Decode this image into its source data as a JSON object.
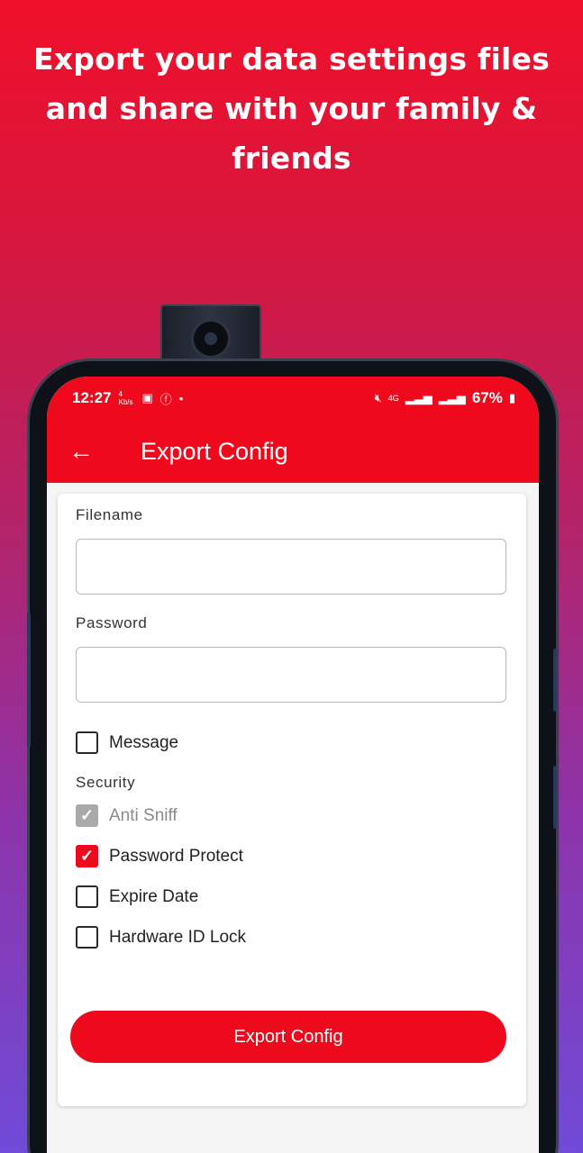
{
  "promo": {
    "headline_line1": "Export your data settings files",
    "headline_line2": "and share with your family &",
    "headline_line3": "friends"
  },
  "status_bar": {
    "time": "12:27",
    "net_speed": "4 Kb/s",
    "battery": "67%"
  },
  "app_bar": {
    "title": "Export Config"
  },
  "form": {
    "filename_label": "Filename",
    "filename_value": "",
    "password_label": "Password",
    "password_value": "",
    "message_label": "Message",
    "message_checked": false,
    "security_label": "Security",
    "options": [
      {
        "label": "Anti Sniff",
        "checked": true,
        "disabled": true
      },
      {
        "label": "Password Protect",
        "checked": true,
        "disabled": false
      },
      {
        "label": "Expire Date",
        "checked": false,
        "disabled": false
      },
      {
        "label": "Hardware ID Lock",
        "checked": false,
        "disabled": false
      }
    ],
    "export_button": "Export Config"
  },
  "colors": {
    "accent": "#ee0a1c",
    "disabled": "#a9a9a9"
  }
}
